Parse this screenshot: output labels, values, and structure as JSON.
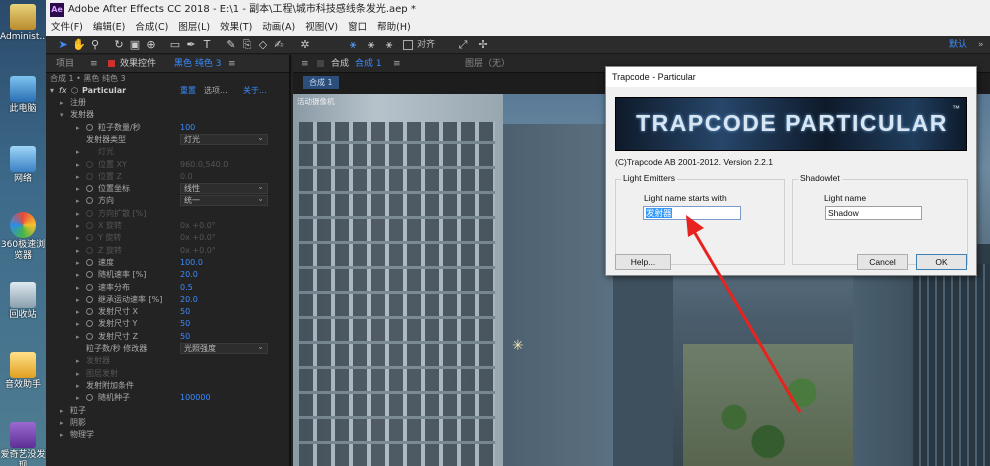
{
  "desktop": {
    "icons": [
      "Administ...",
      "此电脑",
      "网络",
      "360极速浏览器",
      "回收站",
      "音效助手",
      "爱奇艺没发现"
    ]
  },
  "window": {
    "title": "Adobe After Effects CC 2018 - E:\\1 - 副本\\工程\\城市科技感线条发光.aep *",
    "logo": "Ae"
  },
  "menu": [
    "文件(F)",
    "编辑(E)",
    "合成(C)",
    "图层(L)",
    "效果(T)",
    "动画(A)",
    "视图(V)",
    "窗口",
    "帮助(H)"
  ],
  "toolbar": {
    "align_label": "对齐",
    "workspace": "默认"
  },
  "left_panel": {
    "tab_project": "项目",
    "tab_effects": "效果控件",
    "tab_effects_target": "黑色 纯色 3",
    "breadcrumb": "合成 1 • 黑色 纯色 3",
    "effect_name": "Particular",
    "reset": "重置",
    "options": "选项...",
    "about": "关于...",
    "rows": [
      {
        "label": "注册",
        "value": ""
      },
      {
        "label": "发射器",
        "value": ""
      },
      {
        "label": "粒子数量/秒",
        "value": "100"
      },
      {
        "label": "发射器类型",
        "value": "灯光"
      },
      {
        "label": "灯光",
        "value": ""
      },
      {
        "label": "位置 XY",
        "value": "960.0,540.0"
      },
      {
        "label": "位置 Z",
        "value": "0.0"
      },
      {
        "label": "位置坐标",
        "value": "线性"
      },
      {
        "label": "方向",
        "value": "统一"
      },
      {
        "label": "方向扩散 [%]",
        "value": ""
      },
      {
        "label": "X 旋转",
        "value": "0x +0.0°"
      },
      {
        "label": "Y 旋转",
        "value": "0x +0.0°"
      },
      {
        "label": "Z 旋转",
        "value": "0x +0.0°"
      },
      {
        "label": "速度",
        "value": "100.0"
      },
      {
        "label": "随机速率 [%]",
        "value": "20.0"
      },
      {
        "label": "速率分布",
        "value": "0.5"
      },
      {
        "label": "继承运动速率 [%]",
        "value": "20.0"
      },
      {
        "label": "发射尺寸 X",
        "value": "50"
      },
      {
        "label": "发射尺寸 Y",
        "value": "50"
      },
      {
        "label": "发射尺寸 Z",
        "value": "50"
      },
      {
        "label": "粒子数/秒 修改器",
        "value": "光照强度"
      },
      {
        "label": "发射器",
        "value": ""
      },
      {
        "label": "图层发射",
        "value": ""
      },
      {
        "label": "发射附加条件",
        "value": ""
      },
      {
        "label": "随机种子",
        "value": "100000"
      },
      {
        "label": "粒子",
        "value": ""
      },
      {
        "label": "阴影",
        "value": ""
      },
      {
        "label": "物理学",
        "value": ""
      }
    ]
  },
  "comp_panel": {
    "tab_comp": "合成",
    "tab_comp_name": "合成 1",
    "tab_layer": "图层（无）",
    "comp_chip": "合成 1",
    "viewer_label": "活动摄像机"
  },
  "dialog": {
    "title": "Trapcode - Particular",
    "banner": "TRAPCODE PARTICULAR",
    "tm": "™",
    "copyright": "(C)Trapcode AB 2001-2012.  Version 2.2.1",
    "light_emitters_label": "Light Emitters",
    "light_name_starts_label": "Light name starts with",
    "light_name_value": "发射器",
    "shadowlet_label": "Shadowlet",
    "light_name_label": "Light name",
    "shadow_value": "Shadow",
    "help_button": "Help...",
    "cancel_button": "Cancel",
    "ok_button": "OK"
  },
  "colors": {
    "accent": "#3a8cff",
    "arrow": "#e8231f"
  }
}
